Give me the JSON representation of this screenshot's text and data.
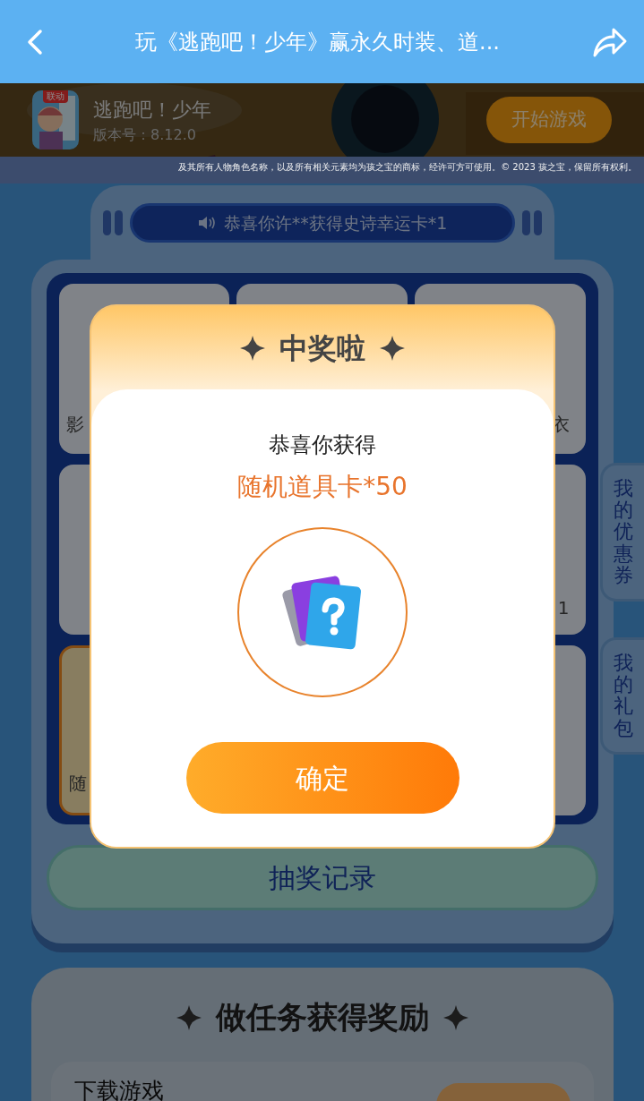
{
  "header": {
    "title": "玩《逃跑吧！少年》赢永久时装、道..."
  },
  "game": {
    "badge": "联动",
    "name": "逃跑吧！少年",
    "version": "版本号：8.12.0",
    "play_button": "开始游戏",
    "copyright": "及其所有人物角色名称，以及所有相关元素均为孩之宝的商标，经许可方可使用。© 2023 孩之宝，保留所有权利。"
  },
  "notice": "恭喜你许**获得史诗幸运卡*1",
  "grid": {
    "cells": [
      {
        "text": "影",
        "selected": false
      },
      {
        "selected": false
      },
      {
        "text": "衣",
        "selected": false
      },
      {
        "selected": false
      },
      {},
      {
        "text": "1",
        "selected": false
      },
      {
        "text": "随",
        "selected": true
      },
      {},
      {
        "selected": false
      }
    ]
  },
  "record_button": "抽奖记录",
  "side_tabs": [
    "我的优惠券",
    "我的礼包"
  ],
  "tasks": {
    "title": "做任务获得奖励",
    "items": [
      {
        "name": "下载游戏"
      }
    ]
  },
  "modal": {
    "title": "中奖啦",
    "message": "恭喜你获得",
    "prize": "随机道具卡*50",
    "confirm_button": "确定"
  }
}
